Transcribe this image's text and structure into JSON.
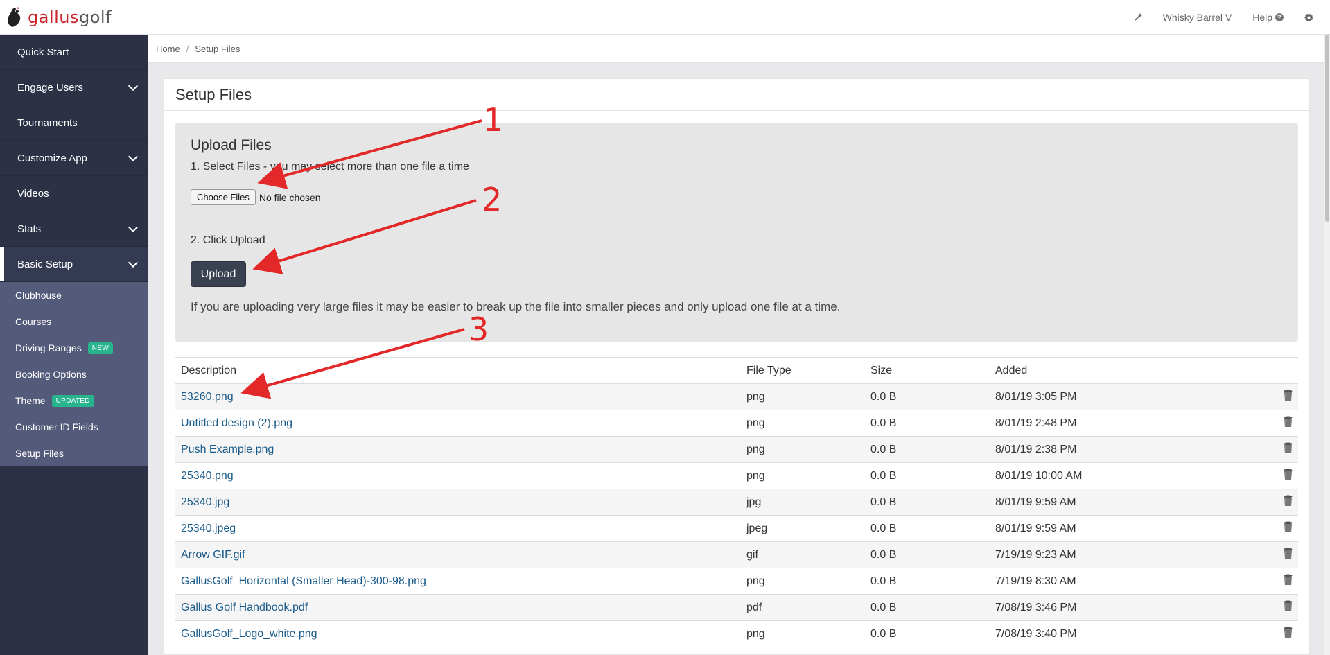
{
  "header": {
    "logo_text_1": "gallus",
    "logo_text_2": "golf",
    "nav": [
      {
        "icon": "magic-wand-icon"
      },
      {
        "label": "Whisky Barrel V"
      },
      {
        "label": "Help",
        "icon": "question-circle-icon"
      },
      {
        "icon": "gear-icon"
      }
    ]
  },
  "sidebar": {
    "items": [
      {
        "label": "Quick Start",
        "expandable": false
      },
      {
        "label": "Engage Users",
        "expandable": true
      },
      {
        "label": "Tournaments",
        "expandable": false
      },
      {
        "label": "Customize App",
        "expandable": true
      },
      {
        "label": "Videos",
        "expandable": false
      },
      {
        "label": "Stats",
        "expandable": true
      },
      {
        "label": "Basic Setup",
        "expandable": true,
        "active": true
      }
    ],
    "subitems": [
      {
        "label": "Clubhouse",
        "badge": ""
      },
      {
        "label": "Courses",
        "badge": ""
      },
      {
        "label": "Driving Ranges",
        "badge": "NEW"
      },
      {
        "label": "Booking Options",
        "badge": ""
      },
      {
        "label": "Theme",
        "badge": "UPDATED"
      },
      {
        "label": "Customer ID Fields",
        "badge": ""
      },
      {
        "label": "Setup Files",
        "badge": ""
      }
    ]
  },
  "breadcrumb": {
    "home": "Home",
    "separator": "/",
    "current": "Setup Files"
  },
  "page": {
    "title": "Setup Files",
    "upload": {
      "title": "Upload Files",
      "step1": "1. Select Files - you may select more than one file a time",
      "choose_label": "Choose Files",
      "no_file": "No file chosen",
      "step2": "2. Click Upload",
      "upload_label": "Upload",
      "hint": "If you are uploading very large files it may be easier to break up the file into smaller pieces and only upload one file at a time."
    },
    "table": {
      "headers": [
        "Description",
        "File Type",
        "Size",
        "Added"
      ],
      "rows": [
        {
          "name": "53260.png",
          "type": "png",
          "size": "0.0 B",
          "added": "8/01/19 3:05 PM"
        },
        {
          "name": "Untitled design (2).png",
          "type": "png",
          "size": "0.0 B",
          "added": "8/01/19 2:48 PM"
        },
        {
          "name": "Push Example.png",
          "type": "png",
          "size": "0.0 B",
          "added": "8/01/19 2:38 PM"
        },
        {
          "name": "25340.png",
          "type": "png",
          "size": "0.0 B",
          "added": "8/01/19 10:00 AM"
        },
        {
          "name": "25340.jpg",
          "type": "jpg",
          "size": "0.0 B",
          "added": "8/01/19 9:59 AM"
        },
        {
          "name": "25340.jpeg",
          "type": "jpeg",
          "size": "0.0 B",
          "added": "8/01/19 9:59 AM"
        },
        {
          "name": "Arrow GIF.gif",
          "type": "gif",
          "size": "0.0 B",
          "added": "7/19/19 9:23 AM"
        },
        {
          "name": "GallusGolf_Horizontal (Smaller Head)-300-98.png",
          "type": "png",
          "size": "0.0 B",
          "added": "7/19/19 8:30 AM"
        },
        {
          "name": "Gallus Golf Handbook.pdf",
          "type": "pdf",
          "size": "0.0 B",
          "added": "7/08/19 3:46 PM"
        },
        {
          "name": "GallusGolf_Logo_white.png",
          "type": "png",
          "size": "0.0 B",
          "added": "7/08/19 3:40 PM"
        }
      ]
    }
  },
  "annotations": [
    "1",
    "2",
    "3"
  ],
  "colors": {
    "annotation": "#e22828",
    "sidebar": "#2c3146",
    "subnav": "#545a7a",
    "badge": "#28b48c",
    "link": "#1a5b8a"
  }
}
